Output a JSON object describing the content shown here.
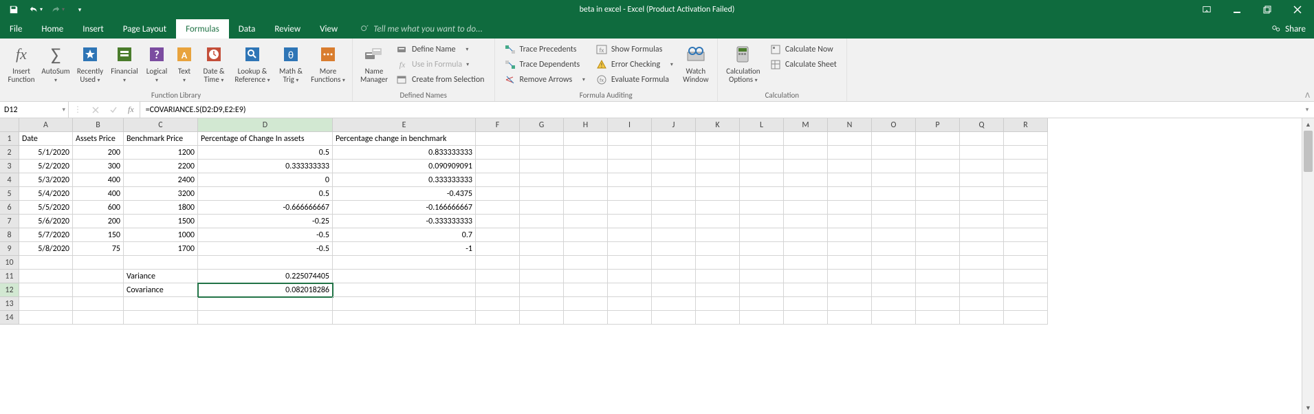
{
  "titlebar": {
    "title": "beta in excel - Excel (Product Activation Failed)"
  },
  "menu": {
    "tabs": [
      "File",
      "Home",
      "Insert",
      "Page Layout",
      "Formulas",
      "Data",
      "Review",
      "View"
    ],
    "active_index": 4,
    "tell_me": "Tell me what you want to do...",
    "share": "Share"
  },
  "ribbon": {
    "groups": {
      "function_library": {
        "label": "Function Library",
        "insert_function": "Insert\nFunction",
        "autosum": "AutoSum",
        "recently_used": "Recently\nUsed",
        "financial": "Financial",
        "logical": "Logical",
        "text": "Text",
        "date_time": "Date &\nTime",
        "lookup_ref": "Lookup &\nReference",
        "math_trig": "Math &\nTrig",
        "more": "More\nFunctions"
      },
      "defined_names": {
        "label": "Defined Names",
        "name_manager": "Name\nManager",
        "define_name": "Define Name",
        "use_formula": "Use in Formula",
        "create_selection": "Create from Selection"
      },
      "formula_auditing": {
        "label": "Formula Auditing",
        "trace_precedents": "Trace Precedents",
        "trace_dependents": "Trace Dependents",
        "remove_arrows": "Remove Arrows",
        "show_formulas": "Show Formulas",
        "error_checking": "Error Checking",
        "evaluate_formula": "Evaluate Formula",
        "watch_window": "Watch\nWindow"
      },
      "calculation": {
        "label": "Calculation",
        "calc_options": "Calculation\nOptions",
        "calc_now": "Calculate Now",
        "calc_sheet": "Calculate Sheet"
      }
    }
  },
  "namebox": {
    "value": "D12"
  },
  "formula": {
    "value": "=COVARIANCE.S(D2:D9,E2:E9)"
  },
  "columns": [
    "A",
    "B",
    "C",
    "D",
    "E",
    "F",
    "G",
    "H",
    "I",
    "J",
    "K",
    "L",
    "M",
    "N",
    "O",
    "P",
    "Q",
    "R"
  ],
  "row_numbers": [
    1,
    2,
    3,
    4,
    5,
    6,
    7,
    8,
    9,
    10,
    11,
    12,
    13,
    14
  ],
  "cells": {
    "headers": {
      "A1": "Date",
      "B1": "Assets Price",
      "C1": "Benchmark Price",
      "D1": "Percentage of Change In assets",
      "E1": "Percentage change in benchmark"
    },
    "data": [
      {
        "date": "5/1/2020",
        "assets": "200",
        "bench": "1200",
        "pct_a": "0.5",
        "pct_b": "0.833333333"
      },
      {
        "date": "5/2/2020",
        "assets": "300",
        "bench": "2200",
        "pct_a": "0.333333333",
        "pct_b": "0.090909091"
      },
      {
        "date": "5/3/2020",
        "assets": "400",
        "bench": "2400",
        "pct_a": "0",
        "pct_b": "0.333333333"
      },
      {
        "date": "5/4/2020",
        "assets": "400",
        "bench": "3200",
        "pct_a": "0.5",
        "pct_b": "-0.4375"
      },
      {
        "date": "5/5/2020",
        "assets": "600",
        "bench": "1800",
        "pct_a": "-0.666666667",
        "pct_b": "-0.166666667"
      },
      {
        "date": "5/6/2020",
        "assets": "200",
        "bench": "1500",
        "pct_a": "-0.25",
        "pct_b": "-0.333333333"
      },
      {
        "date": "5/7/2020",
        "assets": "150",
        "bench": "1000",
        "pct_a": "-0.5",
        "pct_b": "0.7"
      },
      {
        "date": "5/8/2020",
        "assets": "75",
        "bench": "1700",
        "pct_a": "-0.5",
        "pct_b": "-1"
      }
    ],
    "labels": {
      "C11": "Variance",
      "D11": "0.225074405",
      "C12": "Covariance",
      "D12": "0.082018286"
    }
  },
  "selected_cell": "D12"
}
